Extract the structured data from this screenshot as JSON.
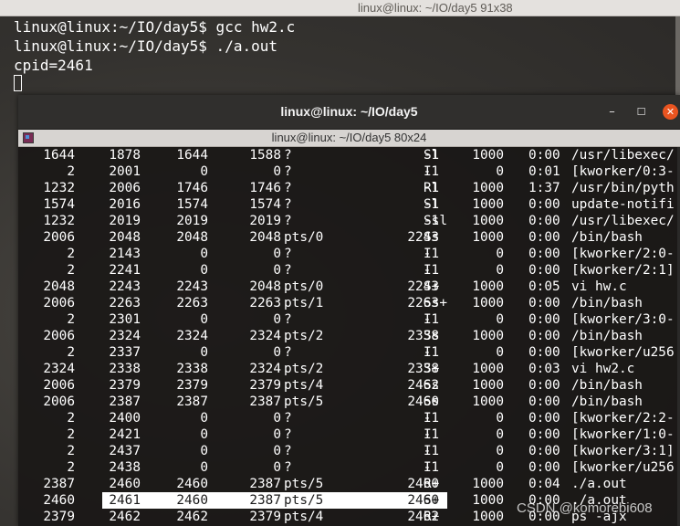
{
  "back_terminal": {
    "title": "linux@linux: ~/IO/day5 91x38",
    "lines": [
      "linux@linux:~/IO/day5$ gcc hw2.c",
      "linux@linux:~/IO/day5$ ./a.out",
      "cpid=2461"
    ]
  },
  "front_terminal": {
    "window_title": "linux@linux: ~/IO/day5",
    "tab_title": "linux@linux: ~/IO/day5 80x24",
    "buttons": {
      "minimize": "–",
      "maximize": "☐",
      "close": "✕"
    },
    "rows": [
      {
        "ppid": "1644",
        "pid": "1878",
        "pgid": "1644",
        "sid": "1588",
        "tty": "?",
        "tpgid": "-1",
        "stat": "Sl",
        "uid": "1000",
        "time": "0:00",
        "cmd": "/usr/libexec/"
      },
      {
        "ppid": "2",
        "pid": "2001",
        "pgid": "0",
        "sid": "0",
        "tty": "?",
        "tpgid": "-1",
        "stat": "I",
        "uid": "0",
        "time": "0:01",
        "cmd": "[kworker/0:3-"
      },
      {
        "ppid": "1232",
        "pid": "2006",
        "pgid": "1746",
        "sid": "1746",
        "tty": "?",
        "tpgid": "-1",
        "stat": "Rl",
        "uid": "1000",
        "time": "1:37",
        "cmd": "/usr/bin/pyth"
      },
      {
        "ppid": "1574",
        "pid": "2016",
        "pgid": "1574",
        "sid": "1574",
        "tty": "?",
        "tpgid": "-1",
        "stat": "Sl",
        "uid": "1000",
        "time": "0:00",
        "cmd": "update-notifi"
      },
      {
        "ppid": "1232",
        "pid": "2019",
        "pgid": "2019",
        "sid": "2019",
        "tty": "?",
        "tpgid": "-1",
        "stat": "Ssl",
        "uid": "1000",
        "time": "0:00",
        "cmd": "/usr/libexec/"
      },
      {
        "ppid": "2006",
        "pid": "2048",
        "pgid": "2048",
        "sid": "2048",
        "tty": "pts/0",
        "tpgid": "2243",
        "stat": "Ss",
        "uid": "1000",
        "time": "0:00",
        "cmd": "/bin/bash"
      },
      {
        "ppid": "2",
        "pid": "2143",
        "pgid": "0",
        "sid": "0",
        "tty": "?",
        "tpgid": "-1",
        "stat": "I",
        "uid": "0",
        "time": "0:00",
        "cmd": "[kworker/2:0-"
      },
      {
        "ppid": "2",
        "pid": "2241",
        "pgid": "0",
        "sid": "0",
        "tty": "?",
        "tpgid": "-1",
        "stat": "I",
        "uid": "0",
        "time": "0:00",
        "cmd": "[kworker/2:1]"
      },
      {
        "ppid": "2048",
        "pid": "2243",
        "pgid": "2243",
        "sid": "2048",
        "tty": "pts/0",
        "tpgid": "2243",
        "stat": "S+",
        "uid": "1000",
        "time": "0:05",
        "cmd": "vi hw.c"
      },
      {
        "ppid": "2006",
        "pid": "2263",
        "pgid": "2263",
        "sid": "2263",
        "tty": "pts/1",
        "tpgid": "2263",
        "stat": "Ss+",
        "uid": "1000",
        "time": "0:00",
        "cmd": "/bin/bash"
      },
      {
        "ppid": "2",
        "pid": "2301",
        "pgid": "0",
        "sid": "0",
        "tty": "?",
        "tpgid": "-1",
        "stat": "I",
        "uid": "0",
        "time": "0:00",
        "cmd": "[kworker/3:0-"
      },
      {
        "ppid": "2006",
        "pid": "2324",
        "pgid": "2324",
        "sid": "2324",
        "tty": "pts/2",
        "tpgid": "2338",
        "stat": "Ss",
        "uid": "1000",
        "time": "0:00",
        "cmd": "/bin/bash"
      },
      {
        "ppid": "2",
        "pid": "2337",
        "pgid": "0",
        "sid": "0",
        "tty": "?",
        "tpgid": "-1",
        "stat": "I",
        "uid": "0",
        "time": "0:00",
        "cmd": "[kworker/u256"
      },
      {
        "ppid": "2324",
        "pid": "2338",
        "pgid": "2338",
        "sid": "2324",
        "tty": "pts/2",
        "tpgid": "2338",
        "stat": "S+",
        "uid": "1000",
        "time": "0:03",
        "cmd": "vi hw2.c"
      },
      {
        "ppid": "2006",
        "pid": "2379",
        "pgid": "2379",
        "sid": "2379",
        "tty": "pts/4",
        "tpgid": "2462",
        "stat": "Ss",
        "uid": "1000",
        "time": "0:00",
        "cmd": "/bin/bash"
      },
      {
        "ppid": "2006",
        "pid": "2387",
        "pgid": "2387",
        "sid": "2387",
        "tty": "pts/5",
        "tpgid": "2460",
        "stat": "Ss",
        "uid": "1000",
        "time": "0:00",
        "cmd": "/bin/bash"
      },
      {
        "ppid": "2",
        "pid": "2400",
        "pgid": "0",
        "sid": "0",
        "tty": "?",
        "tpgid": "-1",
        "stat": "I",
        "uid": "0",
        "time": "0:00",
        "cmd": "[kworker/2:2-"
      },
      {
        "ppid": "2",
        "pid": "2421",
        "pgid": "0",
        "sid": "0",
        "tty": "?",
        "tpgid": "-1",
        "stat": "I",
        "uid": "0",
        "time": "0:00",
        "cmd": "[kworker/1:0-"
      },
      {
        "ppid": "2",
        "pid": "2437",
        "pgid": "0",
        "sid": "0",
        "tty": "?",
        "tpgid": "-1",
        "stat": "I",
        "uid": "0",
        "time": "0:00",
        "cmd": "[kworker/3:1]"
      },
      {
        "ppid": "2",
        "pid": "2438",
        "pgid": "0",
        "sid": "0",
        "tty": "?",
        "tpgid": "-1",
        "stat": "I",
        "uid": "0",
        "time": "0:00",
        "cmd": "[kworker/u256"
      },
      {
        "ppid": "2387",
        "pid": "2460",
        "pgid": "2460",
        "sid": "2387",
        "tty": "pts/5",
        "tpgid": "2460",
        "stat": "R+",
        "uid": "1000",
        "time": "0:04",
        "cmd": "./a.out"
      },
      {
        "ppid": "2460",
        "pid": "2461",
        "pgid": "2460",
        "sid": "2387",
        "tty": "pts/5",
        "tpgid": "2460",
        "stat": "S+",
        "uid": "1000",
        "time": "0:00",
        "cmd": "./a.out",
        "selected": true
      },
      {
        "ppid": "2379",
        "pid": "2462",
        "pgid": "2462",
        "sid": "2379",
        "tty": "pts/4",
        "tpgid": "2462",
        "stat": "R+",
        "uid": "1000",
        "time": "0:00",
        "cmd": "ps -ajx"
      }
    ]
  },
  "watermark": "CSDN @komorebi608",
  "colors": {
    "accent_close": "#e95420",
    "text": "#ffffff",
    "selection": "#ffffff"
  }
}
